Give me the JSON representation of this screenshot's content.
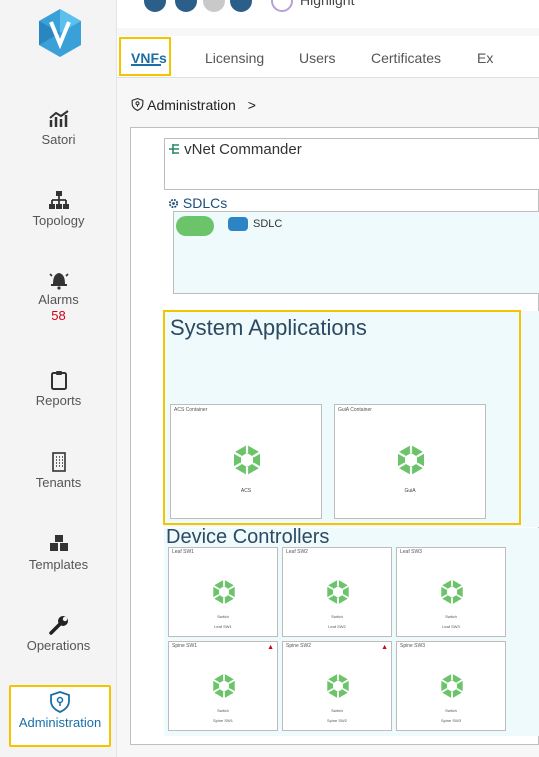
{
  "sidebar": {
    "items": [
      {
        "label": "Satori",
        "icon": "satori-icon"
      },
      {
        "label": "Topology",
        "icon": "topology-icon"
      },
      {
        "label": "Alarms",
        "icon": "alarm-bell-icon",
        "count": "58"
      },
      {
        "label": "Reports",
        "icon": "clipboard-icon"
      },
      {
        "label": "Tenants",
        "icon": "building-icon"
      },
      {
        "label": "Templates",
        "icon": "cubes-icon"
      },
      {
        "label": "Operations",
        "icon": "wrench-icon"
      },
      {
        "label": "Administration",
        "icon": "shield-icon"
      }
    ]
  },
  "topbar": {
    "highlight_label": "Highlight"
  },
  "tabs": [
    {
      "label": "VNFs",
      "active": true
    },
    {
      "label": "Licensing"
    },
    {
      "label": "Users"
    },
    {
      "label": "Certificates"
    },
    {
      "label": "Ex"
    }
  ],
  "breadcrumb": {
    "label": "Administration",
    "separator": ">"
  },
  "vnet": {
    "title": "vNet Commander"
  },
  "sdlcs": {
    "label": "SDLCs",
    "chip_label": "SDLC"
  },
  "system_applications": {
    "title": "System Applications",
    "cards": [
      {
        "caption": "ACS Container",
        "name": "ACS"
      },
      {
        "caption": "GuiA Container",
        "name": "GuiA"
      }
    ]
  },
  "device_controllers": {
    "title": "Device Controllers",
    "cards": [
      {
        "caption": "Leaf SW1",
        "line1": "Switch",
        "line2": "Leaf SW1",
        "alert": false
      },
      {
        "caption": "Leaf SW2",
        "line1": "Switch",
        "line2": "Leaf SW2",
        "alert": false
      },
      {
        "caption": "Leaf SW3",
        "line1": "Switch",
        "line2": "Leaf SW3",
        "alert": false
      },
      {
        "caption": "Spine SW1",
        "line1": "Switch",
        "line2": "Spine SW1",
        "alert": true
      },
      {
        "caption": "Spine SW2",
        "line1": "Switch",
        "line2": "Spine SW2",
        "alert": true
      },
      {
        "caption": "Spine SW3",
        "line1": "Switch",
        "line2": "Spine SW3",
        "alert": false
      }
    ]
  },
  "colors": {
    "accent": "#1a6fa8",
    "highlight_border": "#f5c400",
    "status_green": "#6cc46a",
    "alarm_red": "#d0021b"
  }
}
